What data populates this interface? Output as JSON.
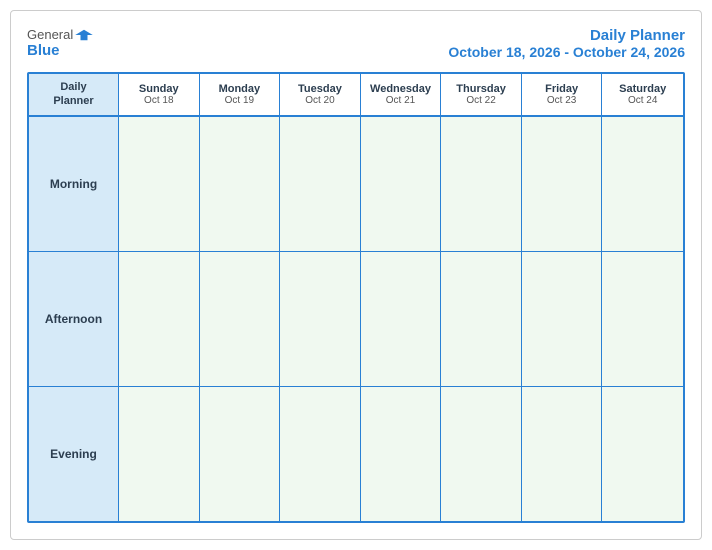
{
  "header": {
    "logo_general": "General",
    "logo_blue": "Blue",
    "title": "Daily Planner",
    "subtitle": "October 18, 2026 - October 24, 2026"
  },
  "columns": [
    {
      "day": "Daily\nPlanner",
      "date": "",
      "is_label": true
    },
    {
      "day": "Sunday",
      "date": "Oct 18"
    },
    {
      "day": "Monday",
      "date": "Oct 19"
    },
    {
      "day": "Tuesday",
      "date": "Oct 20"
    },
    {
      "day": "Wednesday",
      "date": "Oct 21"
    },
    {
      "day": "Thursday",
      "date": "Oct 22"
    },
    {
      "day": "Friday",
      "date": "Oct 23"
    },
    {
      "day": "Saturday",
      "date": "Oct 24"
    }
  ],
  "rows": [
    {
      "label": "Morning"
    },
    {
      "label": "Afternoon"
    },
    {
      "label": "Evening"
    }
  ]
}
